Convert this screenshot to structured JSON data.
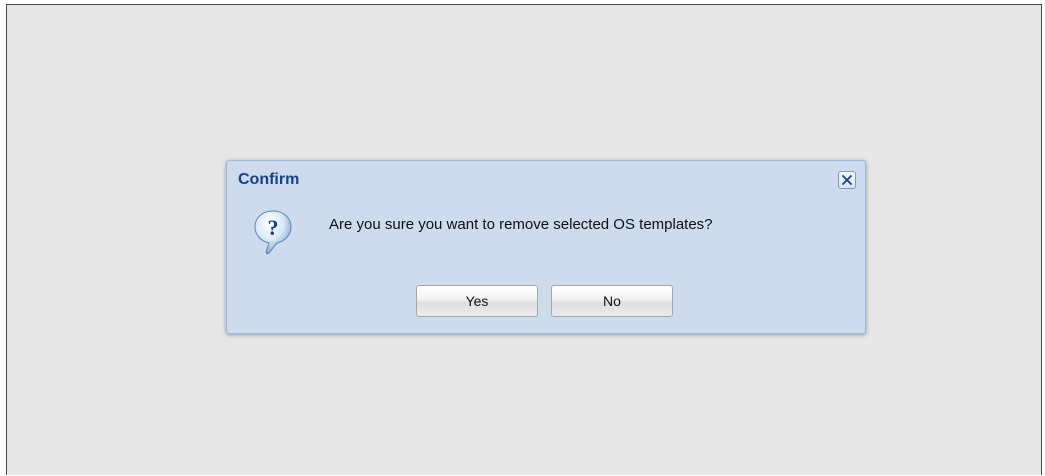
{
  "dialog": {
    "title": "Confirm",
    "message": "Are you sure you want to remove selected OS templates?",
    "icon": "question-icon",
    "close_icon": "close-icon",
    "buttons": {
      "yes_label": "Yes",
      "no_label": "No"
    }
  },
  "colors": {
    "background": "#e7e7e7",
    "dialog_body": "#cddbec",
    "dialog_border": "#99bbe8",
    "title_text": "#15428b"
  }
}
